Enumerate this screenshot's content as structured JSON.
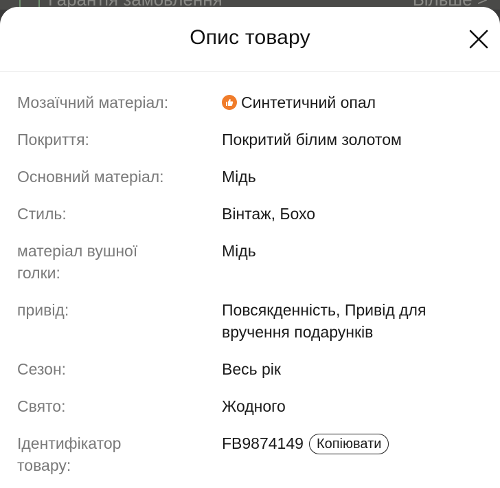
{
  "background": {
    "left_text": "Гарантія замовлення",
    "right_text": "Більше >"
  },
  "modal": {
    "title": "Опис товару"
  },
  "attributes": [
    {
      "label": "Мозаїчний матеріал:",
      "value": "Синтетичний опал"
    },
    {
      "label": "Покриття:",
      "value": "Покритий білим золотом"
    },
    {
      "label": "Основний матеріал:",
      "value": "Мідь"
    },
    {
      "label": "Стиль:",
      "value": "Вінтаж, Бохо"
    },
    {
      "label": "матеріал вушної голки:",
      "value": "Мідь"
    },
    {
      "label": "привід:",
      "value": "Повсякденність, Привід для вручення подарунків"
    },
    {
      "label": "Сезон:",
      "value": "Весь рік"
    },
    {
      "label": "Свято:",
      "value": "Жодного"
    },
    {
      "label": "Ідентифікатор товару:",
      "value": "FB9874149"
    }
  ],
  "copy_label": "Копіювати",
  "colors": {
    "accent_orange": "#f07c2a",
    "label_gray": "#7a7a7a"
  }
}
